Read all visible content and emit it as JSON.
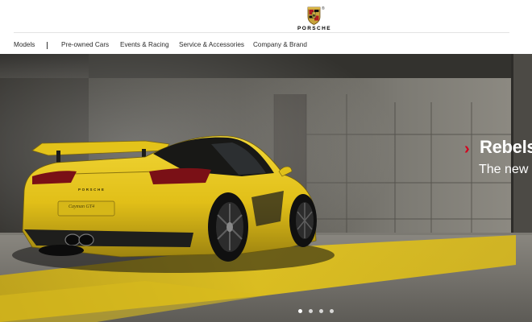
{
  "brand": {
    "logo_icon": "porsche-crest-icon",
    "wordmark": "PORSCHE",
    "reg_mark": "®"
  },
  "nav": {
    "items": [
      {
        "label": "Models"
      },
      {
        "label": "Pre-owned Cars"
      },
      {
        "label": "Events & Racing"
      },
      {
        "label": "Service & Accessories"
      },
      {
        "label": "Company & Brand"
      }
    ]
  },
  "hero": {
    "headline": "Rebels",
    "subheadline": "The new C",
    "chevron_icon": "chevron-right-icon",
    "badge_text": "Cayman GT4",
    "car_brand_text": "PORSCHE",
    "accent_color": "#d5001c",
    "car_color": "#e6c619",
    "carousel": {
      "count": 4,
      "active": 0
    }
  }
}
